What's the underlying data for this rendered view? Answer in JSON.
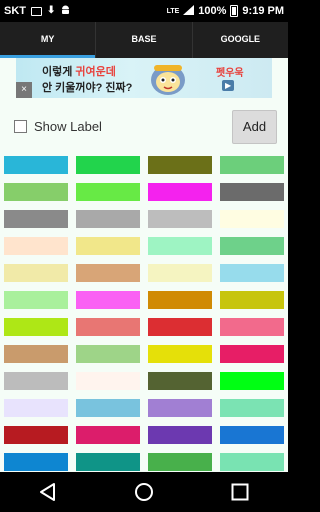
{
  "status_bar": {
    "carrier": "SKT",
    "network": "LTE",
    "battery": "100%",
    "time": "9:19 PM"
  },
  "tabs": [
    {
      "label": "MY",
      "active": true
    },
    {
      "label": "BASE",
      "active": false
    },
    {
      "label": "GOOGLE",
      "active": false
    }
  ],
  "ad": {
    "line1_a": "이렇게 ",
    "line1_b": "귀여운데",
    "line2": "안 키울꺼야? 진짜?",
    "logo": "펫우욱",
    "close": "×"
  },
  "controls": {
    "show_label": "Show Label",
    "show_label_checked": false,
    "add_label": "Add"
  },
  "swatches": [
    [
      "#29b6d8",
      "#22d44c",
      "#6b7018",
      "#6ccf7b"
    ],
    [
      "#86ce6a",
      "#67ea45",
      "#f422ee",
      "#6b6b6b"
    ],
    [
      "#8a8a8a",
      "#a9a9a9",
      "#bdbdbd",
      "#fffde2"
    ],
    [
      "#ffe4cd",
      "#f1e78a",
      "#9ef4c3",
      "#6ed18a"
    ],
    [
      "#f1eaa8",
      "#d8a577",
      "#f5f4c1",
      "#97dcec"
    ],
    [
      "#a9f09c",
      "#fa61f4",
      "#d08a03",
      "#c7c50d"
    ],
    [
      "#aee716",
      "#e87673",
      "#dc2e32",
      "#f26a8c"
    ],
    [
      "#c99b6c",
      "#9ed488",
      "#e5e009",
      "#e71e66"
    ],
    [
      "#bcbcbc",
      "#fff4ee",
      "#546332",
      "#00ff13"
    ],
    [
      "#e8e3fd",
      "#79c3de",
      "#a17fd3",
      "#7be3b3"
    ],
    [
      "#b71b21",
      "#dc1d6b",
      "#6c39b0",
      "#1976d3"
    ],
    [
      "#0e86d1",
      "#0f9487",
      "#48b04b",
      "#79e3b2"
    ]
  ]
}
